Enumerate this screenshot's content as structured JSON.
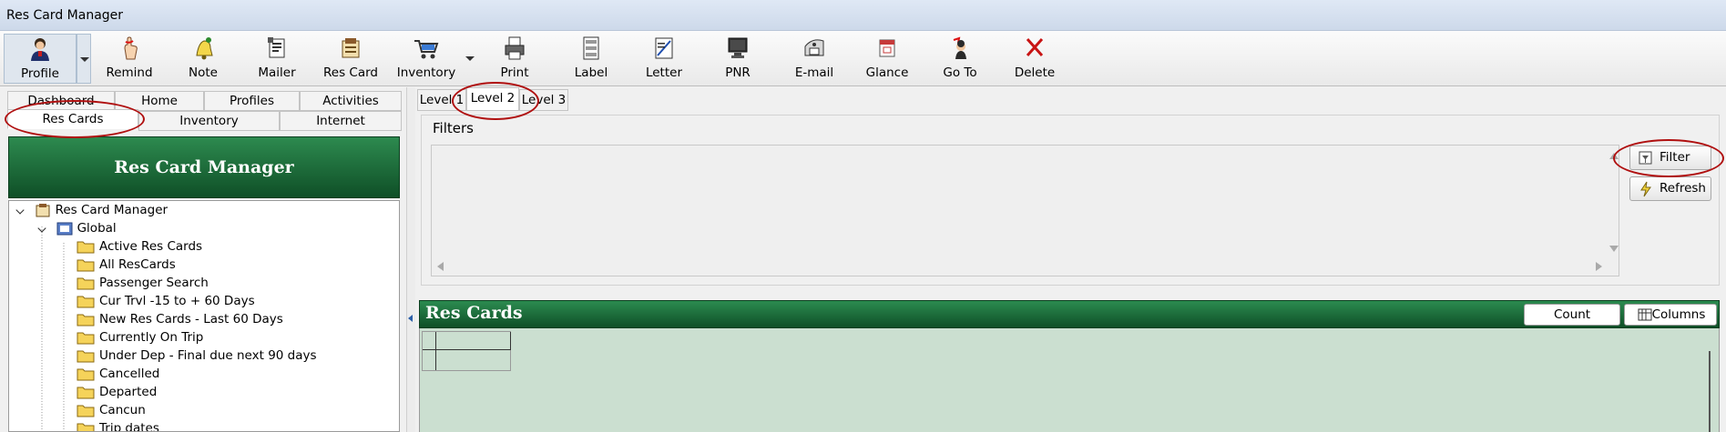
{
  "window": {
    "title": "Res Card Manager"
  },
  "toolbar": {
    "items": [
      {
        "label": "Profile",
        "icon": "person-icon"
      },
      {
        "label": "Remind",
        "icon": "finger-string-icon"
      },
      {
        "label": "Note",
        "icon": "bell-note-icon"
      },
      {
        "label": "Mailer",
        "icon": "mailer-icon"
      },
      {
        "label": "Res Card",
        "icon": "res-card-icon"
      },
      {
        "label": "Inventory",
        "icon": "shopping-cart-icon"
      },
      {
        "label": "Print",
        "icon": "printer-icon"
      },
      {
        "label": "Label",
        "icon": "label-icon"
      },
      {
        "label": "Letter",
        "icon": "letter-icon"
      },
      {
        "label": "PNR",
        "icon": "monitor-icon"
      },
      {
        "label": "E-mail",
        "icon": "email-icon"
      },
      {
        "label": "Glance",
        "icon": "calendar-icon"
      },
      {
        "label": "Go To",
        "icon": "go-to-icon"
      },
      {
        "label": "Delete",
        "icon": "delete-x-icon"
      }
    ]
  },
  "left_tabs": {
    "row1": [
      "Dashboard",
      "Home",
      "Profiles",
      "Activities"
    ],
    "row2": [
      "Res Cards",
      "Inventory",
      "Internet"
    ],
    "active": "Res Cards"
  },
  "left_header": {
    "title": "Res Card Manager"
  },
  "tree": {
    "root": "Res Card Manager",
    "group": "Global",
    "items": [
      "Active Res Cards",
      "All ResCards",
      "Passenger Search",
      "Cur Trvl  -15 to + 60 Days",
      "New Res Cards - Last 60 Days",
      "Currently On Trip",
      "Under Dep - Final due next 90 days",
      "Cancelled",
      "Departed",
      "Cancun",
      "Trip dates"
    ]
  },
  "right_tabs": {
    "items": [
      "Level 1",
      "Level 2",
      "Level 3"
    ],
    "active": "Level 2"
  },
  "filters": {
    "legend": "Filters",
    "filter_button": "Filter",
    "refresh_button": "Refresh"
  },
  "grid": {
    "title": "Res Cards",
    "count_button": "Count",
    "columns_button": "Columns"
  },
  "colors": {
    "header_green": "#1b6b39",
    "grid_background": "#cbdfd0",
    "annotation_red": "#b01010"
  }
}
